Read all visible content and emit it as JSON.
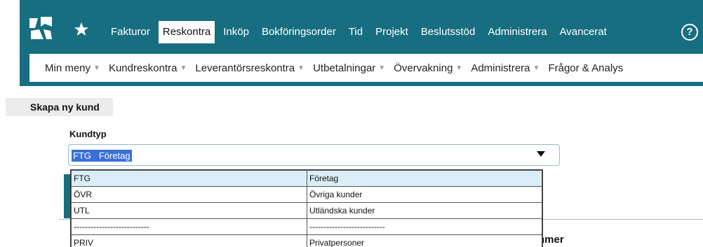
{
  "topnav": {
    "items": [
      {
        "label": "Fakturor",
        "active": false
      },
      {
        "label": "Reskontra",
        "active": true
      },
      {
        "label": "Inköp",
        "active": false
      },
      {
        "label": "Bokföringsorder",
        "active": false
      },
      {
        "label": "Tid",
        "active": false
      },
      {
        "label": "Projekt",
        "active": false
      },
      {
        "label": "Beslutsstöd",
        "active": false
      },
      {
        "label": "Administrera",
        "active": false
      },
      {
        "label": "Avancerat",
        "active": false
      }
    ],
    "help_label": "?"
  },
  "subnav": {
    "items": [
      {
        "label": "Min meny"
      },
      {
        "label": "Kundreskontra"
      },
      {
        "label": "Leverantörsreskontra"
      },
      {
        "label": "Utbetalningar"
      },
      {
        "label": "Övervakning"
      },
      {
        "label": "Administrera"
      },
      {
        "label": "Frågor & Analys"
      }
    ]
  },
  "page": {
    "create_button": "Skapa ny kund",
    "kundtyp_label": "Kundtyp",
    "selected_value": "FTG   Företag",
    "partial_text": "nmer"
  },
  "dropdown": {
    "options": [
      {
        "code": "FTG",
        "name": "Företag",
        "highlighted": true
      },
      {
        "code": "ÖVR",
        "name": "Övriga kunder",
        "highlighted": false
      },
      {
        "code": "UTL",
        "name": "Utländska kunder",
        "highlighted": false
      },
      {
        "code": "---------------------------",
        "name": "---------------------------",
        "highlighted": false
      },
      {
        "code": "PRIV",
        "name": "Privatpersoner",
        "highlighted": false
      }
    ]
  },
  "colors": {
    "brand_teal": "#176e80",
    "selection_blue": "#3b6fd9",
    "highlight_row": "#dbeef7"
  }
}
